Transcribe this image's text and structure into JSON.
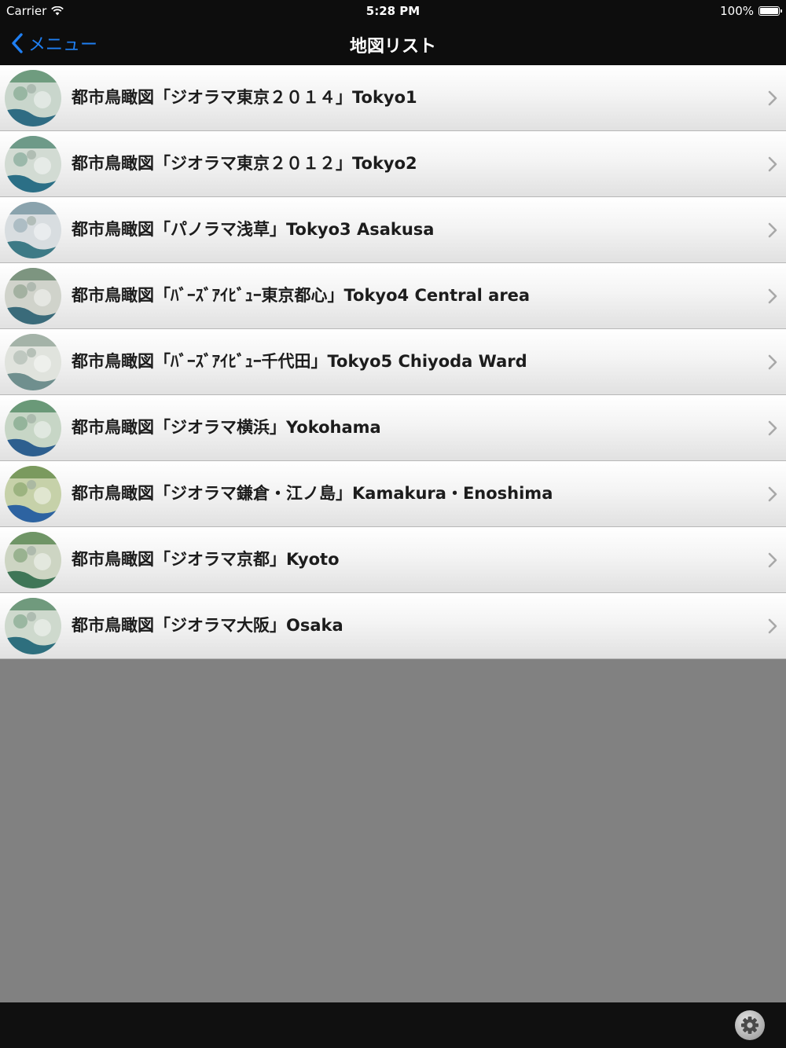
{
  "status_bar": {
    "carrier": "Carrier",
    "time": "5:28 PM",
    "battery": "100%",
    "battery_level": 1.0
  },
  "nav": {
    "back_label": "メニュー",
    "title": "地図リスト"
  },
  "accent_color": "#1f7ff2",
  "rows": [
    {
      "label": "都市鳥瞰図「ジオラマ東京２０１４」Tokyo1"
    },
    {
      "label": "都市鳥瞰図「ジオラマ東京２０１２」Tokyo2"
    },
    {
      "label": "都市鳥瞰図「パノラマ浅草」Tokyo3 Asakusa"
    },
    {
      "label": "都市鳥瞰図「ﾊﾞｰｽﾞｱｲﾋﾞｭｰ東京都心」Tokyo4 Central area"
    },
    {
      "label": "都市鳥瞰図「ﾊﾞｰｽﾞｱｲﾋﾞｭｰ千代田」Tokyo5 Chiyoda Ward"
    },
    {
      "label": "都市鳥瞰図「ジオラマ横浜」Yokohama"
    },
    {
      "label": "都市鳥瞰図「ジオラマ鎌倉・江ノ島」Kamakura・Enoshima"
    },
    {
      "label": "都市鳥瞰図「ジオラマ京都」Kyoto"
    },
    {
      "label": "都市鳥瞰図「ジオラマ大阪」Osaka"
    }
  ],
  "icons": {
    "status": [
      "wifi-icon",
      "battery-icon"
    ],
    "back": "chevron-left-icon",
    "row_disclosure": "chevron-right-icon",
    "row_thumbnail": "map-thumbnail-icon",
    "toolbar": "gear-icon"
  }
}
